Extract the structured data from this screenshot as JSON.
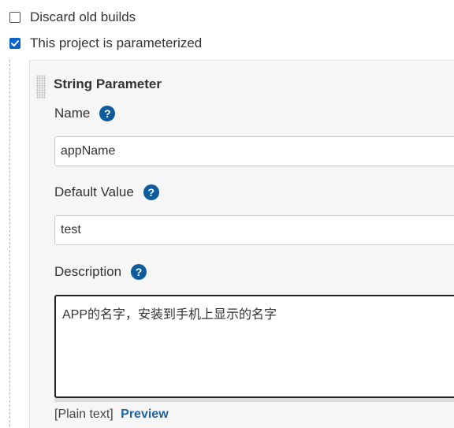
{
  "options": {
    "discard_old_builds": {
      "label": "Discard old builds",
      "checked": false
    },
    "parameterized": {
      "label": "This project is parameterized",
      "checked": true
    }
  },
  "parameter": {
    "type_title": "String Parameter",
    "name": {
      "label": "Name",
      "value": "appName"
    },
    "default_value": {
      "label": "Default Value",
      "value": "test"
    },
    "description": {
      "label": "Description",
      "value": "APP的名字，安装到手机上显示的名字"
    },
    "markup": {
      "plain_text": "[Plain text]",
      "preview": "Preview"
    }
  },
  "icons": {
    "help": "help-question-icon",
    "check": "checkmark-icon",
    "drag": "drag-handle-icon"
  },
  "colors": {
    "accent": "#0a64c8",
    "help_icon": "#0d5c9e",
    "link": "#1d63a8",
    "panel_bg": "#f6f6f6"
  }
}
